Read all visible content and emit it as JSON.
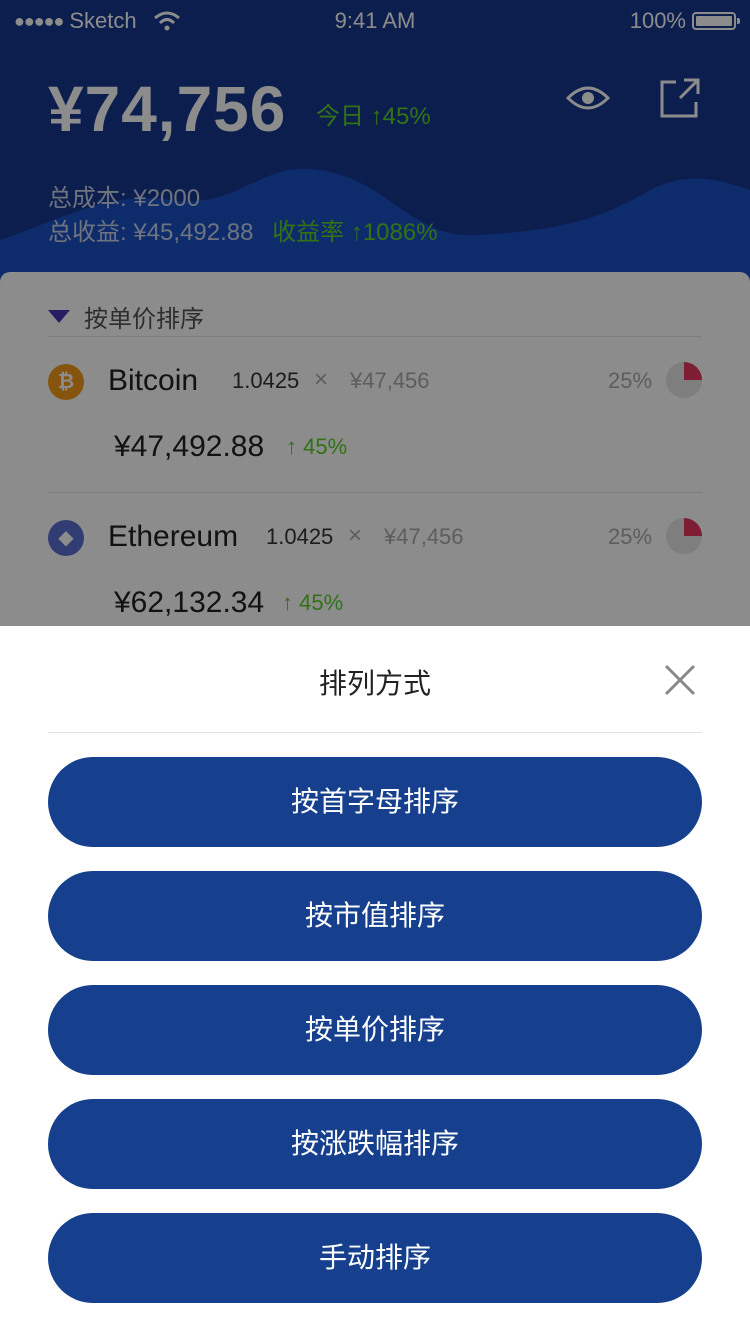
{
  "status_bar": {
    "carrier": "Sketch",
    "time": "9:41 AM",
    "battery": "100%"
  },
  "header": {
    "balance": "¥74,756",
    "today_label": "今日",
    "today_change": "45%",
    "total_cost_label": "总成本:",
    "total_cost": "¥2000",
    "total_profit_label": "总收益:",
    "total_profit": "¥45,492.88",
    "profit_rate_label": "收益率",
    "profit_rate": "1086%"
  },
  "list": {
    "sort_label": "按单价排序",
    "coins": [
      {
        "name": "Bitcoin",
        "symbol_icon": "bitcoin-icon",
        "quantity": "1.0425",
        "times": "×",
        "unit_price": "¥47,456",
        "percent": "25%",
        "value": "¥47,492.88",
        "change": "45%"
      },
      {
        "name": "Ethereum",
        "symbol_icon": "ethereum-icon",
        "quantity": "1.0425",
        "times": "×",
        "unit_price": "¥47,456",
        "percent": "25%",
        "value": "¥62,132.34",
        "change": "45%"
      }
    ]
  },
  "sheet": {
    "title": "排列方式",
    "options": [
      "按首字母排序",
      "按市值排序",
      "按单价排序",
      "按涨跌幅排序",
      "手动排序"
    ]
  },
  "colors": {
    "brand_blue": "#16408e",
    "header_blue": "#16378e",
    "positive_green": "#5bd02a",
    "bitcoin_orange": "#f39b1b",
    "ethereum_blue": "#5a6fd0",
    "pie_red": "#e6365f"
  }
}
